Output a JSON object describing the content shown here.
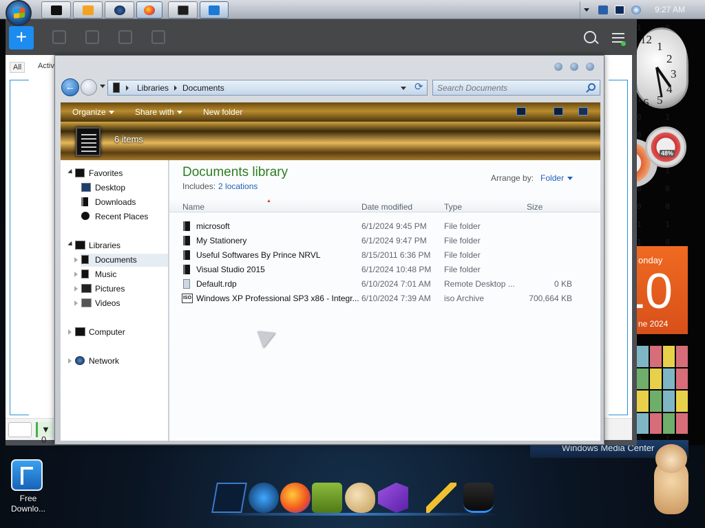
{
  "taskbar": {
    "clock": "9:27 AM"
  },
  "bg_app": {
    "plus_label": "+",
    "tabs": [
      "All",
      "Activ"
    ],
    "footer_count": "▼ 0"
  },
  "explorer": {
    "breadcrumb": [
      "Libraries",
      "Documents"
    ],
    "search_placeholder": "Search Documents",
    "commands": {
      "organize": "Organize",
      "share_with": "Share with",
      "new_folder": "New folder"
    },
    "item_count": "6 items",
    "library_title": "Documents library",
    "includes_label": "Includes:",
    "includes_link": "2 locations",
    "arrange_label": "Arrange by:",
    "arrange_value": "Folder",
    "columns": {
      "name": "Name",
      "date": "Date modified",
      "type": "Type",
      "size": "Size"
    },
    "nav": {
      "favorites": "Favorites",
      "desktop": "Desktop",
      "downloads": "Downloads",
      "recent": "Recent Places",
      "libraries": "Libraries",
      "documents": "Documents",
      "music": "Music",
      "pictures": "Pictures",
      "videos": "Videos",
      "computer": "Computer",
      "network": "Network"
    },
    "files": [
      {
        "name": "microsoft",
        "date": "6/1/2024 9:45 PM",
        "type": "File folder",
        "size": "",
        "icon": "folder-icon"
      },
      {
        "name": "My Stationery",
        "date": "6/1/2024 9:47 PM",
        "type": "File folder",
        "size": "",
        "icon": "folder-icon"
      },
      {
        "name": "Useful Softwares By Prince NRVL",
        "date": "8/15/2011 6:36 PM",
        "type": "File folder",
        "size": "",
        "icon": "folder-icon"
      },
      {
        "name": "Visual Studio 2015",
        "date": "6/1/2024 10:48 PM",
        "type": "File folder",
        "size": "",
        "icon": "folder-icon"
      },
      {
        "name": "Default.rdp",
        "date": "6/10/2024 7:01 AM",
        "type": "Remote Desktop ...",
        "size": "0 KB",
        "icon": "rdp-file-icon"
      },
      {
        "name": "Windows XP Professional SP3 x86 - Integr...",
        "date": "6/10/2024 7:39 AM",
        "type": "iso Archive",
        "size": "700,664 KB",
        "icon": "iso-file-icon"
      }
    ]
  },
  "gadgets": {
    "calendar_day": "onday",
    "calendar_number": "10",
    "calendar_month": "ne 2024",
    "meter_percent": "48%",
    "media_center": "Windows Media Center"
  },
  "desktop": {
    "free_download_label": "Free Downlo..."
  }
}
